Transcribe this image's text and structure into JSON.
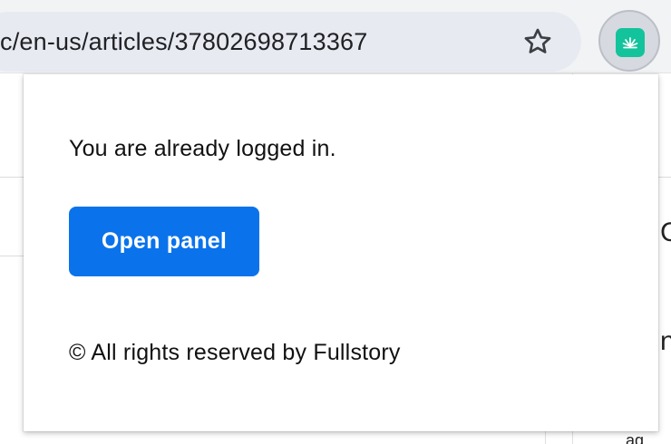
{
  "browser": {
    "url": "c/en-us/articles/37802698713367",
    "bookmark_icon": "star-icon",
    "extension_icon": "fullstory-logo-icon",
    "extension_color": "#13c39b"
  },
  "background_page": {
    "right_glyph_1": "C",
    "right_glyph_2": "na",
    "right_glyph_3": "ag"
  },
  "popup": {
    "status": "You are already logged in.",
    "open_panel_label": "Open panel",
    "copyright": "© All rights reserved by Fullstory",
    "button_color": "#0a73eb"
  }
}
